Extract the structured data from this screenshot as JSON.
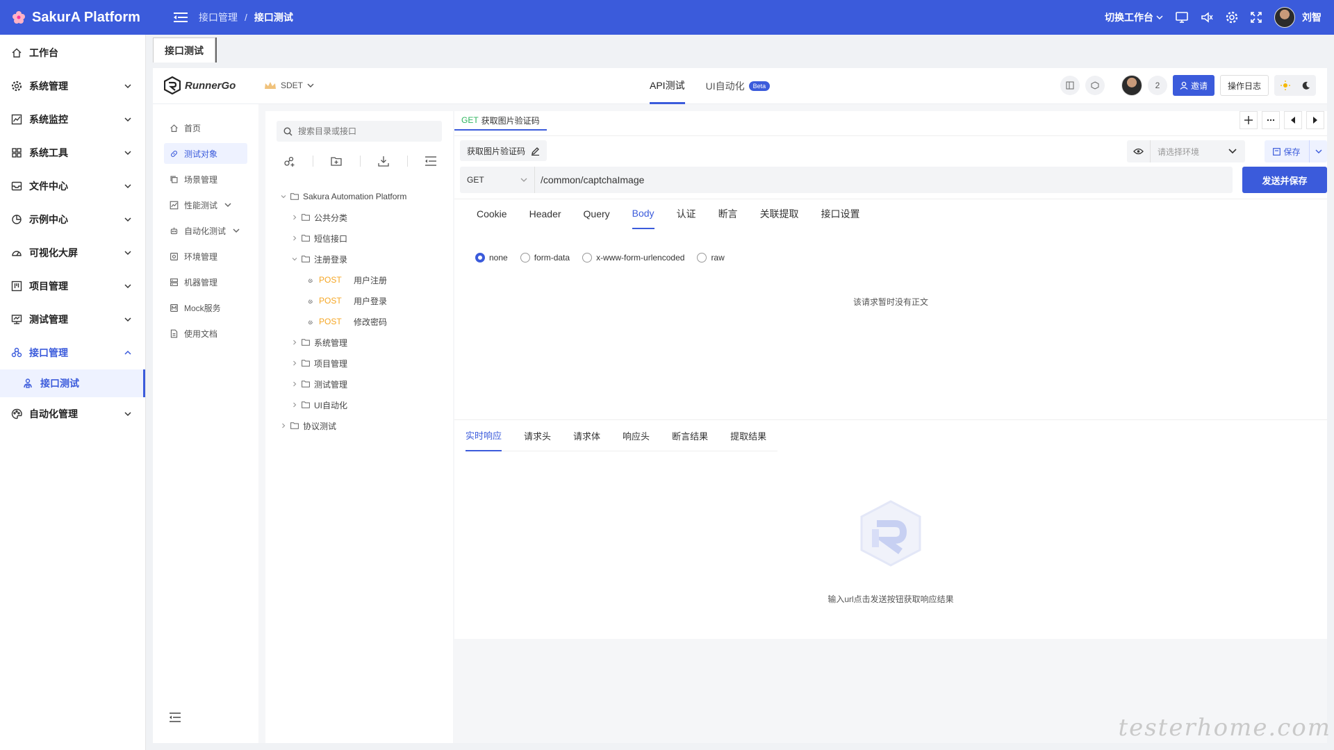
{
  "topbar": {
    "brand": "SakurA Platform",
    "breadcrumb": [
      "接口管理",
      "接口测试"
    ],
    "separator": "/",
    "workspace_switch": "切换工作台",
    "username": "刘智",
    "icons": [
      "monitor-icon",
      "volume-icon",
      "gear-icon",
      "fullscreen-icon"
    ],
    "color": "#3b5bdb"
  },
  "sidebar": {
    "items": [
      {
        "label": "工作台",
        "icon": "home-icon",
        "expandable": false
      },
      {
        "label": "系统管理",
        "icon": "gear-icon",
        "expandable": true
      },
      {
        "label": "系统监控",
        "icon": "chart-icon",
        "expandable": true
      },
      {
        "label": "系统工具",
        "icon": "grid-icon",
        "expandable": true
      },
      {
        "label": "文件中心",
        "icon": "inbox-icon",
        "expandable": true
      },
      {
        "label": "示例中心",
        "icon": "pie-icon",
        "expandable": true
      },
      {
        "label": "可视化大屏",
        "icon": "dashboard-icon",
        "expandable": true
      },
      {
        "label": "项目管理",
        "icon": "kanban-icon",
        "expandable": true
      },
      {
        "label": "测试管理",
        "icon": "screen-icon",
        "expandable": true
      },
      {
        "label": "接口管理",
        "icon": "api-icon",
        "expandable": true,
        "expanded": true
      },
      {
        "label": "自动化管理",
        "icon": "palette-icon",
        "expandable": true
      }
    ],
    "sub_item": "接口测试"
  },
  "page_tab": "接口测试",
  "runnergo": {
    "logo": "RunnerGo",
    "team": "SDET",
    "mode_tabs": [
      {
        "label": "API测试",
        "active": true
      },
      {
        "label": "UI自动化",
        "badge": "Beta"
      }
    ],
    "member_count": "2",
    "invite_label": "邀请",
    "log_label": "操作日志",
    "nav": [
      {
        "label": "首页",
        "icon": "home-icon"
      },
      {
        "label": "测试对象",
        "icon": "link-icon",
        "active": true
      },
      {
        "label": "场景管理",
        "icon": "copy-icon"
      },
      {
        "label": "性能测试",
        "icon": "chart-icon",
        "expandable": true
      },
      {
        "label": "自动化测试",
        "icon": "robot-icon",
        "expandable": true
      },
      {
        "label": "环境管理",
        "icon": "env-icon"
      },
      {
        "label": "机器管理",
        "icon": "server-icon"
      },
      {
        "label": "Mock服务",
        "icon": "mock-icon"
      },
      {
        "label": "使用文档",
        "icon": "doc-icon"
      }
    ]
  },
  "tree": {
    "search_placeholder": "搜索目录或接口",
    "root": "Sakura Automation Platform",
    "folders": [
      {
        "label": "公共分类",
        "expanded": false
      },
      {
        "label": "短信接口",
        "expanded": false
      },
      {
        "label": "注册登录",
        "expanded": true,
        "children": [
          {
            "method": "POST",
            "label": "用户注册"
          },
          {
            "method": "POST",
            "label": "用户登录"
          },
          {
            "method": "POST",
            "label": "修改密码"
          }
        ]
      },
      {
        "label": "系统管理",
        "expanded": false
      },
      {
        "label": "项目管理",
        "expanded": false
      },
      {
        "label": "测试管理",
        "expanded": false
      },
      {
        "label": "UI自动化",
        "expanded": false
      }
    ],
    "root2": "协议测试"
  },
  "editor": {
    "open_tab": {
      "method": "GET",
      "label": "获取图片验证码"
    },
    "api_name": "获取图片验证码",
    "env_placeholder": "请选择环境",
    "save_label": "保存",
    "method": "GET",
    "url": "/common/captchaImage",
    "send_label": "发送并保存",
    "request_tabs": [
      "Cookie",
      "Header",
      "Query",
      "Body",
      "认证",
      "断言",
      "关联提取",
      "接口设置"
    ],
    "active_request_tab": "Body",
    "body_types": [
      "none",
      "form-data",
      "x-www-form-urlencoded",
      "raw"
    ],
    "selected_body_type": "none",
    "empty_body_text": "该请求暂时没有正文",
    "response_tabs": [
      "实时响应",
      "请求头",
      "请求体",
      "响应头",
      "断言结果",
      "提取结果"
    ],
    "active_response_tab": "实时响应",
    "empty_response_text": "输入url点击发送按钮获取响应结果"
  },
  "watermark": "testerhome.com"
}
